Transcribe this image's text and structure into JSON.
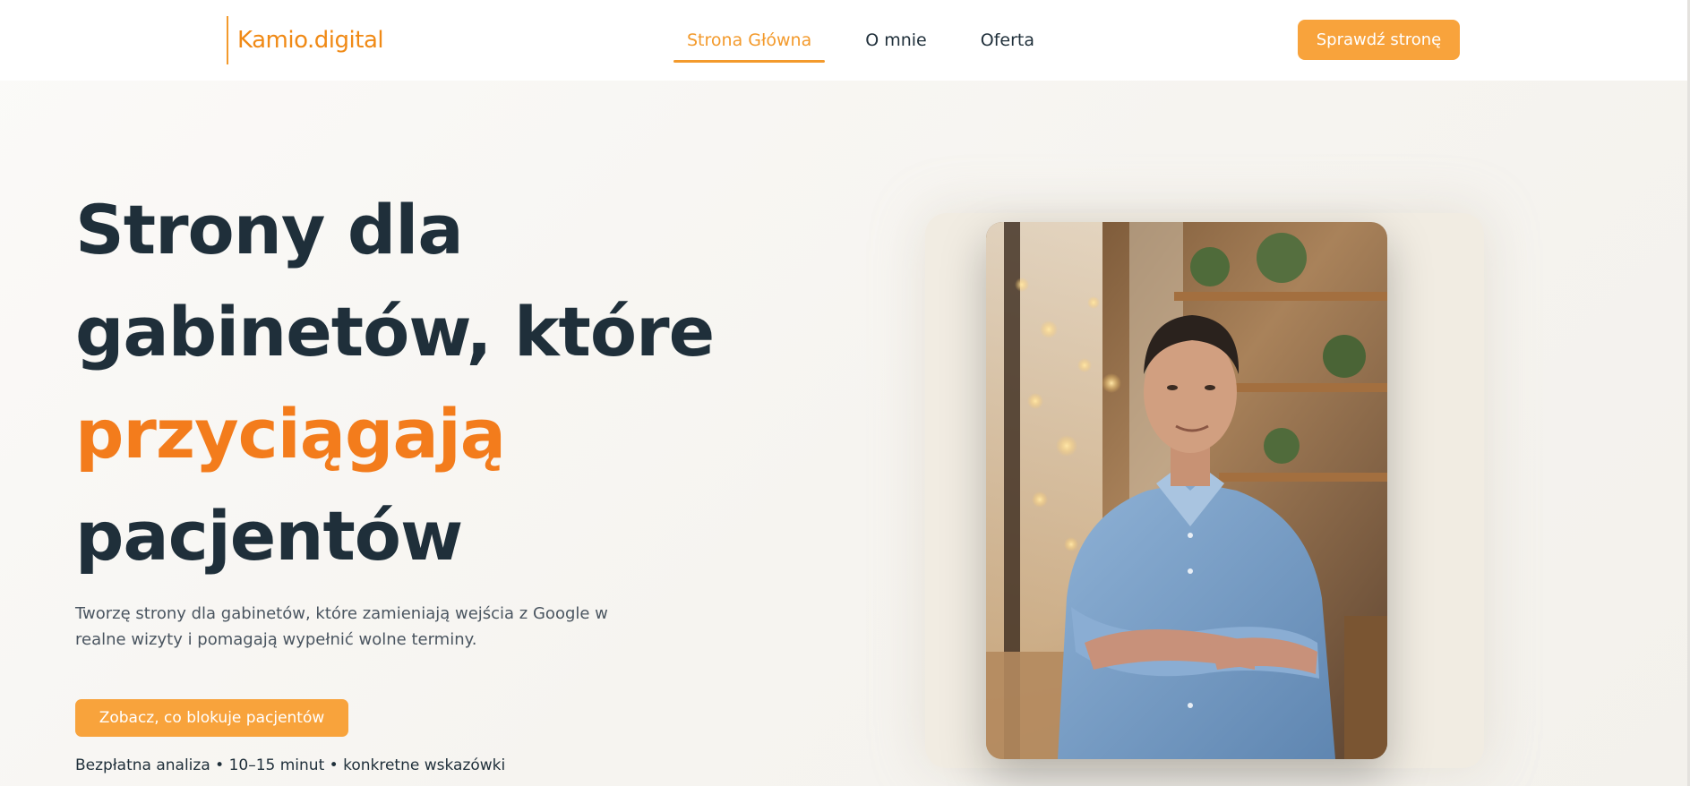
{
  "header": {
    "logo": "Kamio.digital",
    "nav": [
      {
        "label": "Strona Główna",
        "active": true
      },
      {
        "label": "O mnie",
        "active": false
      },
      {
        "label": "Oferta",
        "active": false
      }
    ],
    "cta_label": "Sprawdź stronę"
  },
  "hero": {
    "title_line_1": "Strony dla",
    "title_line_2": "gabinetów, które",
    "title_accent": "przyciągają",
    "title_line_4": "pacjentów",
    "subtitle": "Tworzę strony dla gabinetów, które zamieniają wejścia z Google w realne wizyty i pomagają wypełnić wolne terminy.",
    "cta_label": "Zobacz, co blokuje pacjentów",
    "note": "Bezpłatna analiza • 10–15 minut • konkretne wskazówki"
  },
  "colors": {
    "accent": "#f39a2c",
    "accent_text": "#f37c1c",
    "button": "#f8a33c",
    "heading": "#1f2f3a",
    "body_text": "#4a5560"
  },
  "icons": {
    "portrait": "portrait-photo"
  }
}
